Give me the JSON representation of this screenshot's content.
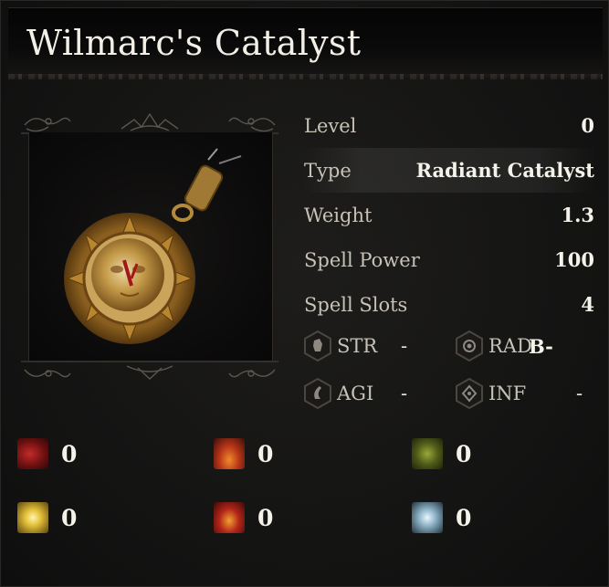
{
  "item": {
    "name": "Wilmarc's Catalyst"
  },
  "stats": [
    {
      "label": "Level",
      "value": "0"
    },
    {
      "label": "Type",
      "value": "Radiant Catalyst"
    },
    {
      "label": "Weight",
      "value": "1.3"
    },
    {
      "label": "Spell Power",
      "value": "100"
    },
    {
      "label": "Spell Slots",
      "value": "4"
    }
  ],
  "requirements": [
    {
      "label": "STR",
      "value": "-",
      "icon": "strength-hex-icon"
    },
    {
      "label": "RAD",
      "value": "B-",
      "icon": "radiance-hex-icon"
    },
    {
      "label": "AGI",
      "value": "-",
      "icon": "agility-hex-icon"
    },
    {
      "label": "INF",
      "value": "-",
      "icon": "inferno-hex-icon"
    }
  ],
  "affinities": [
    {
      "icon": "blood-damage-icon",
      "value": "0",
      "color": "#8a1a1a"
    },
    {
      "icon": "fire-damage-icon",
      "value": "0",
      "color": "#c2461a"
    },
    {
      "icon": "poison-damage-icon",
      "value": "0",
      "color": "#5c6b1e"
    },
    {
      "icon": "radiant-damage-icon",
      "value": "0",
      "color": "#e6c23a"
    },
    {
      "icon": "inferno-damage-icon",
      "value": "0",
      "color": "#b3261a"
    },
    {
      "icon": "frost-damage-icon",
      "value": "0",
      "color": "#8ab0c4"
    }
  ]
}
